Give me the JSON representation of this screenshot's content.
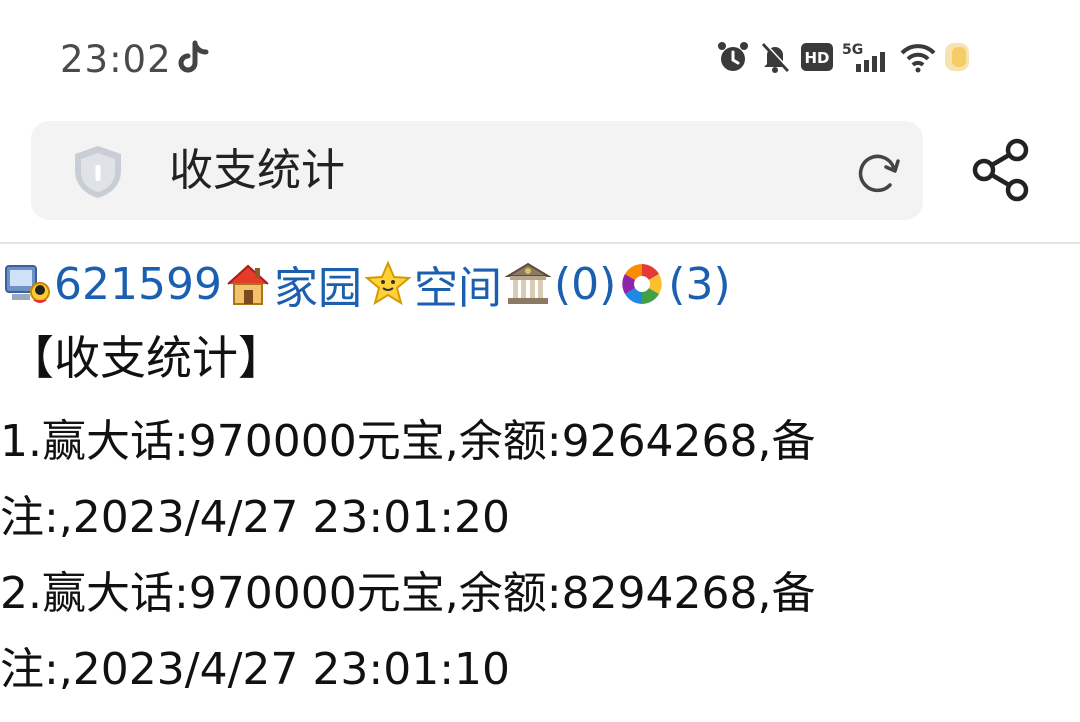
{
  "status_bar": {
    "time": "23:02",
    "icons": [
      "tiktok-icon",
      "alarm-icon",
      "mute-icon",
      "hd-icon",
      "5g-signal-icon",
      "wifi-icon",
      "battery-icon"
    ],
    "hd_label": "HD",
    "network_label": "5G"
  },
  "address_bar": {
    "title": "收支统计",
    "left_icon": "shield-icon",
    "reload_icon": "reload-icon",
    "share_icon": "share-icon"
  },
  "nav": {
    "user_id": "621599",
    "home_label": "家园",
    "space_label": "空间",
    "bank_count": "(0)",
    "photo_count": "(3)"
  },
  "section": {
    "title": "【收支统计】"
  },
  "entries": [
    {
      "line1": "1.赢大话:970000元宝,余额:9264268,备",
      "line2": "注:,2023/4/27 23:01:20"
    },
    {
      "line1": "2.赢大话:970000元宝,余额:8294268,备",
      "line2": "注:,2023/4/27 23:01:10"
    }
  ],
  "colors": {
    "link": "#1b5fb0",
    "text": "#111111",
    "address_bg": "#f3f3f4"
  }
}
